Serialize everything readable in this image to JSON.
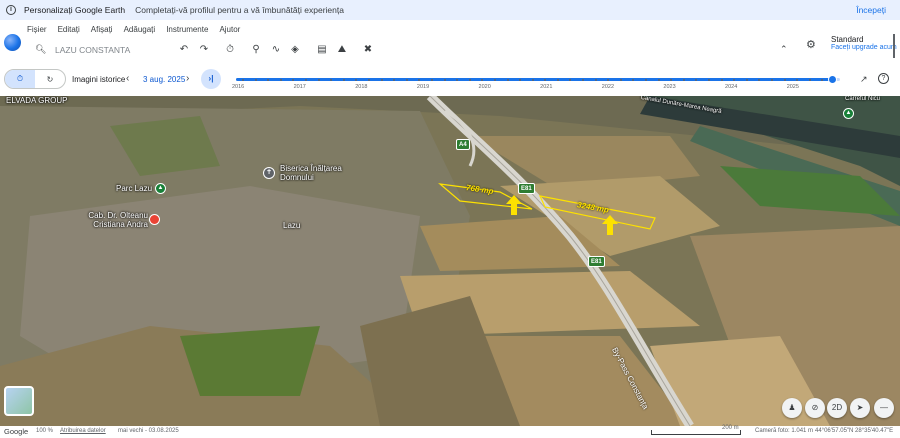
{
  "banner": {
    "title": "Personalizați Google Earth",
    "subtitle": "Completați-vă profilul pentru a vă îmbunătăți experiența",
    "cta": "Începeți"
  },
  "menu": [
    "Fișier",
    "Editați",
    "Afișați",
    "Adăugați",
    "Instrumente",
    "Ajutor"
  ],
  "search": {
    "value": "LAZU CONSTANTA"
  },
  "toolbar_icons": [
    "undo-icon",
    "redo-icon",
    "history-icon",
    "place-icon",
    "path-icon",
    "layers-icon",
    "measure-icon",
    "image-icon",
    "share-icon",
    "collapse-icon"
  ],
  "account": {
    "plan": "Standard",
    "upgrade": "Faceți upgrade acum"
  },
  "history": {
    "label": "Imagini istorice",
    "date": "3 aug. 2025",
    "years": [
      "2016",
      "2017",
      "2018",
      "2019",
      "2020",
      "2021",
      "2022",
      "2023",
      "2024",
      "2025"
    ],
    "position": 0.988
  },
  "map": {
    "labels": {
      "elvada": "ELVADA GROUP",
      "canal": "Canalul Dunăre-Marea Neagră",
      "parc": "Parc Lazu",
      "biserica": "Biserica Înălțarea Domnului",
      "cabinet": "Cab. Dr. Olteanu Cristiana Andra",
      "lazu": "Lazu",
      "bypass": "By-Pass Constanța",
      "topright": "Carreful Nicu"
    },
    "shields": [
      "A4",
      "E81",
      "E81"
    ],
    "areas": [
      "768 mp",
      "3248 mp"
    ]
  },
  "status": {
    "google": "Google",
    "zoom": "100 %",
    "attribution": "Atribuirea datelor",
    "oldest": "mai vechi - 03.08.2025",
    "scale": "200 m",
    "camera": "Cameră foto: 1.041 m",
    "coords": "44°06'57.05\"N 28°35'40.47\"E"
  },
  "colors": {
    "accent": "#1a73e8",
    "area": "#fde100",
    "banner": "#e8f0fe"
  }
}
